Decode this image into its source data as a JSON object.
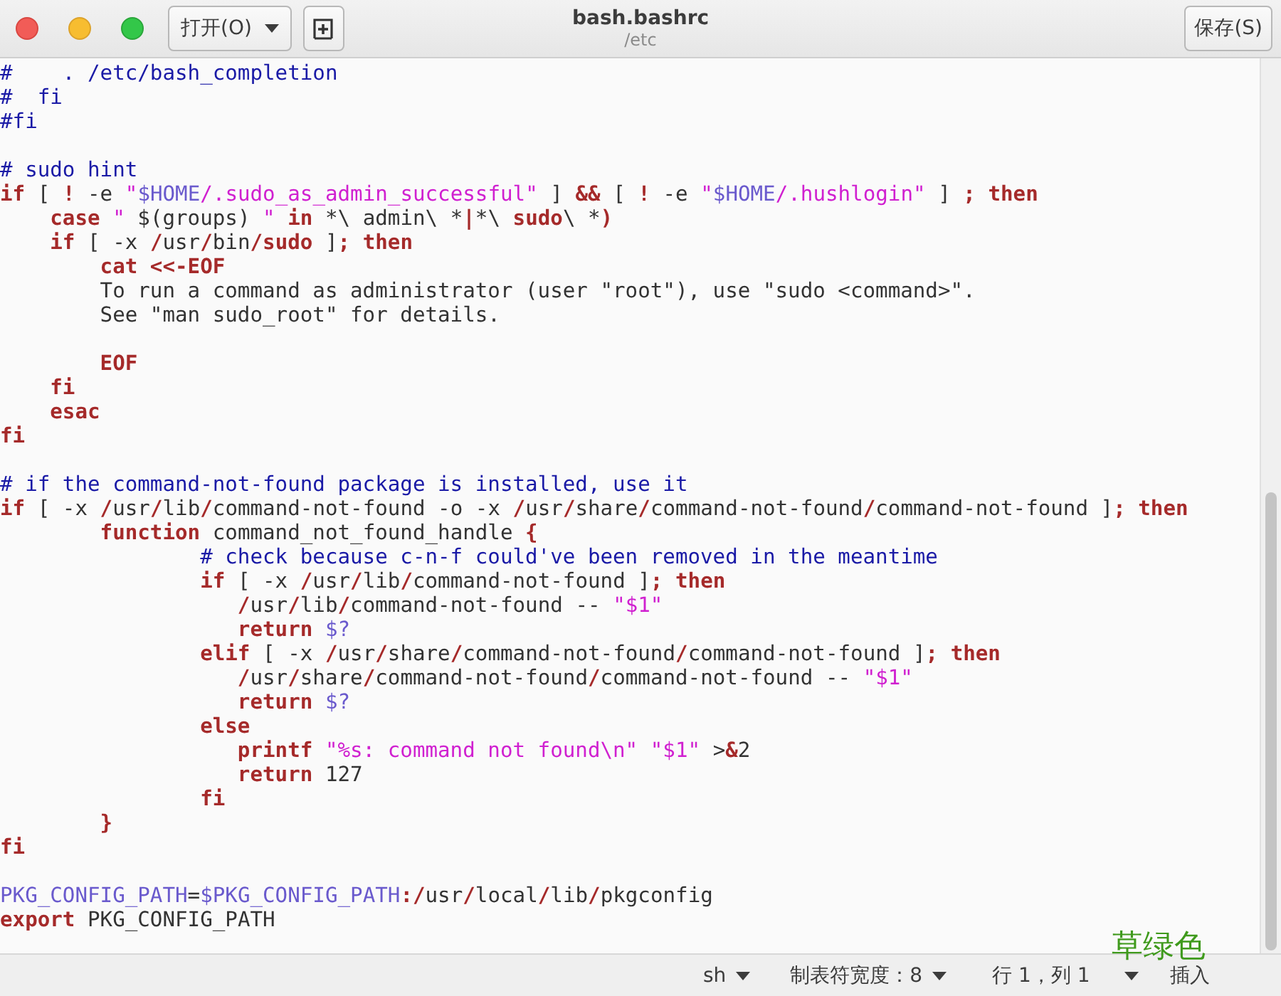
{
  "window": {
    "title": "bash.bashrc",
    "subtitle": "/etc"
  },
  "header": {
    "open_button": "打开(O)",
    "save_button": "保存(S)"
  },
  "editor": {
    "lines": [
      {
        "tokens": [
          {
            "kind": "comment",
            "text": "#    . /etc/bash_completion"
          }
        ]
      },
      {
        "tokens": [
          {
            "kind": "comment",
            "text": "#  fi"
          }
        ]
      },
      {
        "tokens": [
          {
            "kind": "comment",
            "text": "#fi"
          }
        ]
      },
      {
        "kind": "blank"
      },
      {
        "tokens": [
          {
            "kind": "comment",
            "text": "# sudo hint"
          }
        ]
      },
      {
        "tokens": [
          {
            "kind": "keyword",
            "text": "if"
          },
          {
            "kind": "plain",
            "text": " [ "
          },
          {
            "kind": "keyword",
            "text": "!"
          },
          {
            "kind": "plain",
            "text": " -e "
          },
          {
            "kind": "string",
            "text": "\""
          },
          {
            "kind": "variable",
            "text": "$HOME"
          },
          {
            "kind": "string",
            "text": "/.sudo_as_admin_successful\""
          },
          {
            "kind": "plain",
            "text": " ] "
          },
          {
            "kind": "keyword",
            "text": "&&"
          },
          {
            "kind": "plain",
            "text": " [ "
          },
          {
            "kind": "keyword",
            "text": "!"
          },
          {
            "kind": "plain",
            "text": " -e "
          },
          {
            "kind": "string",
            "text": "\""
          },
          {
            "kind": "variable",
            "text": "$HOME"
          },
          {
            "kind": "string",
            "text": "/.hushlogin\""
          },
          {
            "kind": "plain",
            "text": " ] "
          },
          {
            "kind": "keyword",
            "text": "; then"
          }
        ]
      },
      {
        "tokens": [
          {
            "kind": "keyword",
            "text": "    case"
          },
          {
            "kind": "string",
            "text": " \""
          },
          {
            "kind": "plain",
            "text": " $(groups) "
          },
          {
            "kind": "string",
            "text": "\""
          },
          {
            "kind": "keyword",
            "text": " in"
          },
          {
            "kind": "plain",
            "text": " *\\ admin\\ *"
          },
          {
            "kind": "keyword",
            "text": "|"
          },
          {
            "kind": "plain",
            "text": "*\\ "
          },
          {
            "kind": "keyword",
            "text": "sudo"
          },
          {
            "kind": "plain",
            "text": "\\ *"
          },
          {
            "kind": "keyword",
            "text": ")"
          }
        ]
      },
      {
        "tokens": [
          {
            "kind": "keyword",
            "text": "    if"
          },
          {
            "kind": "plain",
            "text": " [ -x "
          },
          {
            "kind": "keyword",
            "text": "/"
          },
          {
            "kind": "plain",
            "text": "usr"
          },
          {
            "kind": "keyword",
            "text": "/"
          },
          {
            "kind": "plain",
            "text": "bin"
          },
          {
            "kind": "keyword",
            "text": "/sudo"
          },
          {
            "kind": "plain",
            "text": " ]"
          },
          {
            "kind": "keyword",
            "text": "; then"
          }
        ]
      },
      {
        "tokens": [
          {
            "kind": "keyword",
            "text": "        cat <<-EOF"
          }
        ]
      },
      {
        "tokens": [
          {
            "kind": "plain",
            "text": "        To run a command as administrator (user \"root\"), use \"sudo <command>\"."
          }
        ]
      },
      {
        "tokens": [
          {
            "kind": "plain",
            "text": "        See \"man sudo_root\" for details."
          }
        ]
      },
      {
        "kind": "blank"
      },
      {
        "tokens": [
          {
            "kind": "keyword",
            "text": "        EOF"
          }
        ]
      },
      {
        "tokens": [
          {
            "kind": "keyword",
            "text": "    fi"
          }
        ]
      },
      {
        "tokens": [
          {
            "kind": "keyword",
            "text": "    esac"
          }
        ]
      },
      {
        "tokens": [
          {
            "kind": "keyword",
            "text": "fi"
          }
        ]
      },
      {
        "kind": "blank"
      },
      {
        "tokens": [
          {
            "kind": "comment",
            "text": "# if the command-not-found package is installed, use it"
          }
        ]
      },
      {
        "tokens": [
          {
            "kind": "keyword",
            "text": "if"
          },
          {
            "kind": "plain",
            "text": " [ -x "
          },
          {
            "kind": "keyword",
            "text": "/"
          },
          {
            "kind": "plain",
            "text": "usr"
          },
          {
            "kind": "keyword",
            "text": "/"
          },
          {
            "kind": "plain",
            "text": "lib"
          },
          {
            "kind": "keyword",
            "text": "/"
          },
          {
            "kind": "plain",
            "text": "command-not-found -o -x "
          },
          {
            "kind": "keyword",
            "text": "/"
          },
          {
            "kind": "plain",
            "text": "usr"
          },
          {
            "kind": "keyword",
            "text": "/"
          },
          {
            "kind": "plain",
            "text": "share"
          },
          {
            "kind": "keyword",
            "text": "/"
          },
          {
            "kind": "plain",
            "text": "command-not-found"
          },
          {
            "kind": "keyword",
            "text": "/"
          },
          {
            "kind": "plain",
            "text": "command-not-found ]"
          },
          {
            "kind": "keyword",
            "text": "; then"
          }
        ]
      },
      {
        "tokens": [
          {
            "kind": "keyword",
            "text": "        function"
          },
          {
            "kind": "plain",
            "text": " command_not_found_handle "
          },
          {
            "kind": "keyword",
            "text": "{"
          }
        ]
      },
      {
        "tokens": [
          {
            "kind": "comment",
            "text": "                # check because c-n-f could've been removed in the meantime"
          }
        ]
      },
      {
        "tokens": [
          {
            "kind": "keyword",
            "text": "                if"
          },
          {
            "kind": "plain",
            "text": " [ -x "
          },
          {
            "kind": "keyword",
            "text": "/"
          },
          {
            "kind": "plain",
            "text": "usr"
          },
          {
            "kind": "keyword",
            "text": "/"
          },
          {
            "kind": "plain",
            "text": "lib"
          },
          {
            "kind": "keyword",
            "text": "/"
          },
          {
            "kind": "plain",
            "text": "command-not-found ]"
          },
          {
            "kind": "keyword",
            "text": "; then"
          }
        ]
      },
      {
        "tokens": [
          {
            "kind": "keyword",
            "text": "                   /"
          },
          {
            "kind": "plain",
            "text": "usr"
          },
          {
            "kind": "keyword",
            "text": "/"
          },
          {
            "kind": "plain",
            "text": "lib"
          },
          {
            "kind": "keyword",
            "text": "/"
          },
          {
            "kind": "plain",
            "text": "command-not-found -- "
          },
          {
            "kind": "string",
            "text": "\"$1\""
          }
        ]
      },
      {
        "tokens": [
          {
            "kind": "keyword",
            "text": "                   return"
          },
          {
            "kind": "variable",
            "text": " $?"
          }
        ]
      },
      {
        "tokens": [
          {
            "kind": "keyword",
            "text": "                elif"
          },
          {
            "kind": "plain",
            "text": " [ -x "
          },
          {
            "kind": "keyword",
            "text": "/"
          },
          {
            "kind": "plain",
            "text": "usr"
          },
          {
            "kind": "keyword",
            "text": "/"
          },
          {
            "kind": "plain",
            "text": "share"
          },
          {
            "kind": "keyword",
            "text": "/"
          },
          {
            "kind": "plain",
            "text": "command-not-found"
          },
          {
            "kind": "keyword",
            "text": "/"
          },
          {
            "kind": "plain",
            "text": "command-not-found ]"
          },
          {
            "kind": "keyword",
            "text": "; then"
          }
        ]
      },
      {
        "tokens": [
          {
            "kind": "keyword",
            "text": "                   /"
          },
          {
            "kind": "plain",
            "text": "usr"
          },
          {
            "kind": "keyword",
            "text": "/"
          },
          {
            "kind": "plain",
            "text": "share"
          },
          {
            "kind": "keyword",
            "text": "/"
          },
          {
            "kind": "plain",
            "text": "command-not-found"
          },
          {
            "kind": "keyword",
            "text": "/"
          },
          {
            "kind": "plain",
            "text": "command-not-found -- "
          },
          {
            "kind": "string",
            "text": "\"$1\""
          }
        ]
      },
      {
        "tokens": [
          {
            "kind": "keyword",
            "text": "                   return"
          },
          {
            "kind": "variable",
            "text": " $?"
          }
        ]
      },
      {
        "tokens": [
          {
            "kind": "keyword",
            "text": "                else"
          }
        ]
      },
      {
        "tokens": [
          {
            "kind": "keyword",
            "text": "                   printf"
          },
          {
            "kind": "string",
            "text": " \"%s: command not found\\n\""
          },
          {
            "kind": "string",
            "text": " \"$1\""
          },
          {
            "kind": "plain",
            "text": " >"
          },
          {
            "kind": "keyword",
            "text": "&"
          },
          {
            "kind": "plain",
            "text": "2"
          }
        ]
      },
      {
        "tokens": [
          {
            "kind": "keyword",
            "text": "                   return"
          },
          {
            "kind": "plain",
            "text": " 127"
          }
        ]
      },
      {
        "tokens": [
          {
            "kind": "keyword",
            "text": "                fi"
          }
        ]
      },
      {
        "tokens": [
          {
            "kind": "keyword",
            "text": "        }"
          }
        ]
      },
      {
        "tokens": [
          {
            "kind": "keyword",
            "text": "fi"
          }
        ]
      },
      {
        "kind": "blank"
      },
      {
        "tokens": [
          {
            "kind": "variable",
            "text": "PKG_CONFIG_PATH"
          },
          {
            "kind": "plain",
            "text": "="
          },
          {
            "kind": "variable",
            "text": "$PKG_CONFIG_PATH"
          },
          {
            "kind": "keyword",
            "text": ":/"
          },
          {
            "kind": "plain",
            "text": "usr"
          },
          {
            "kind": "keyword",
            "text": "/"
          },
          {
            "kind": "plain",
            "text": "local"
          },
          {
            "kind": "keyword",
            "text": "/"
          },
          {
            "kind": "plain",
            "text": "lib"
          },
          {
            "kind": "keyword",
            "text": "/"
          },
          {
            "kind": "plain",
            "text": "pkgconfig"
          }
        ]
      },
      {
        "tokens": [
          {
            "kind": "keyword",
            "text": "export"
          },
          {
            "kind": "plain",
            "text": " PKG_CONFIG_PATH"
          }
        ]
      }
    ]
  },
  "status_bar": {
    "language": "sh",
    "tab_width": "制表符宽度：8",
    "position": "行 1，列 1",
    "mode": "插入"
  },
  "annotation": "草绿色"
}
